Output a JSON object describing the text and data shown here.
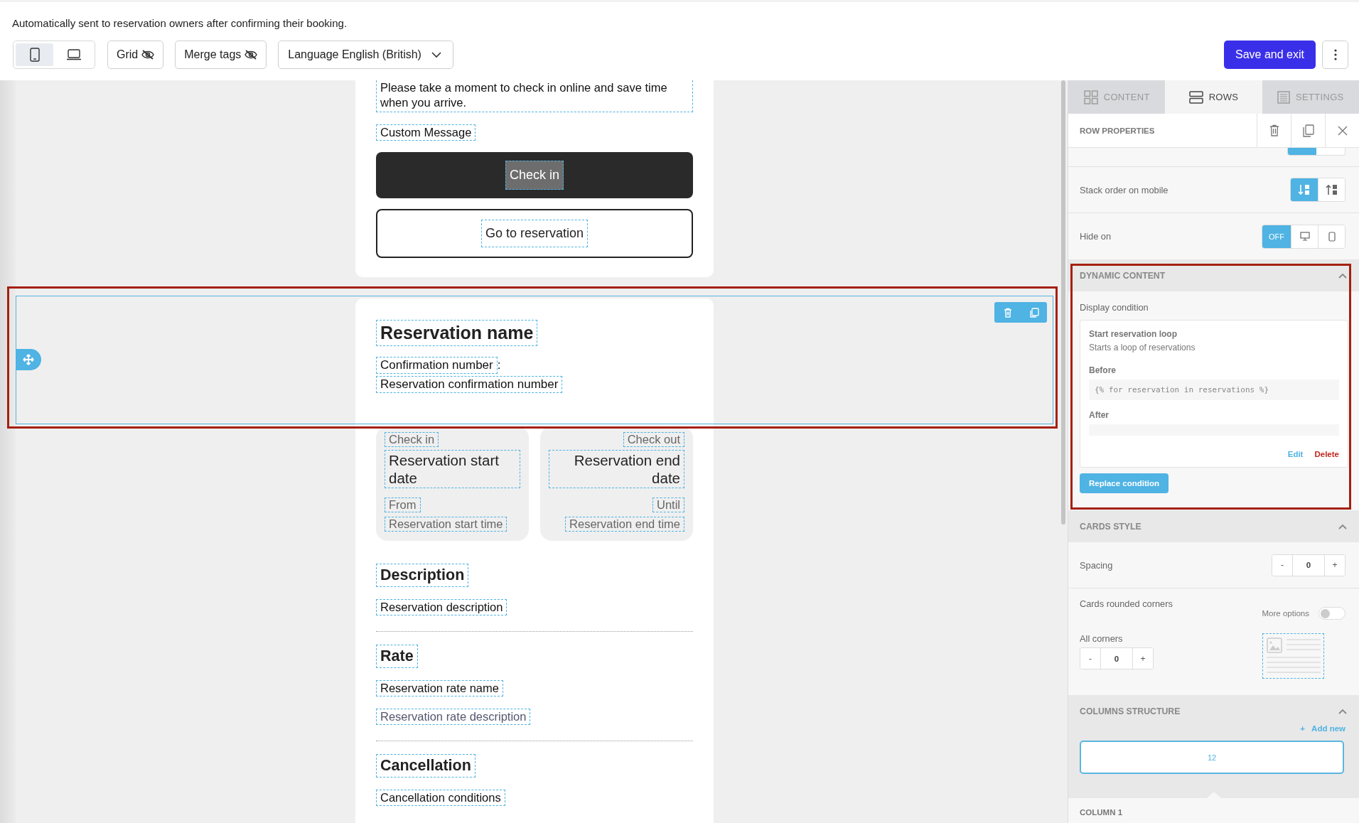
{
  "header": {
    "description": "Automatically sent to reservation owners after confirming their booking."
  },
  "toolbar": {
    "view_modes": [
      {
        "kind": "mobile",
        "selected": true
      },
      {
        "kind": "desktop",
        "selected": false
      }
    ],
    "toggles": [
      {
        "label": "Grid",
        "visible": false
      },
      {
        "label": "Merge tags",
        "visible": false
      }
    ],
    "language": "Language English (British)",
    "save_button": "Save and exit"
  },
  "email": {
    "intro_text": "Please take a moment to check in online and save time when you arrive.",
    "custom_message": "Custom Message",
    "primary_button": "Check in",
    "secondary_button": "Go to reservation",
    "selected_row": {
      "title": "Reservation name",
      "confirmation_label": "Confirmation number",
      "separator": ":",
      "confirmation_value": "Reservation confirmation number"
    },
    "stay_cards": [
      {
        "kind": "left",
        "label": "Check in",
        "date": "Reservation start date",
        "time_label": "From",
        "time": "Reservation start time"
      },
      {
        "kind": "right",
        "label": "Check out",
        "date": "Reservation end date",
        "time_label": "Until",
        "time": "Reservation end time"
      }
    ],
    "sections": [
      {
        "heading": "Description",
        "lines": [
          {
            "text": "Reservation description",
            "muted": false
          }
        ]
      },
      {
        "heading": "Rate",
        "lines": [
          {
            "text": "Reservation rate name",
            "muted": false
          },
          {
            "text": "Reservation rate description",
            "muted": true
          }
        ]
      },
      {
        "heading": "Cancellation",
        "lines": [
          {
            "text": "Cancellation conditions",
            "muted": false
          }
        ]
      }
    ]
  },
  "panel": {
    "tabs": [
      {
        "kind": "grid",
        "label": "CONTENT",
        "selected": false
      },
      {
        "kind": "rows",
        "label": "ROWS",
        "selected": true
      },
      {
        "kind": "lines",
        "label": "SETTINGS",
        "selected": false
      }
    ],
    "title": "ROW PROPERTIES",
    "partial_control": [
      {
        "selected": true
      },
      {
        "selected": false
      }
    ],
    "stack_order": {
      "label": "Stack order on mobile",
      "options": [
        {
          "kind": "down",
          "selected": true
        },
        {
          "kind": "up",
          "selected": false
        }
      ]
    },
    "hide_on": {
      "label": "Hide on",
      "options": [
        {
          "kind": "off",
          "label": "OFF",
          "selected": true
        },
        {
          "kind": "desktop",
          "selected": false
        },
        {
          "kind": "mobile",
          "selected": false
        }
      ]
    },
    "dynamic_content": {
      "title": "DYNAMIC CONTENT",
      "expanded": true,
      "field_label": "Display condition",
      "condition": {
        "name": "Start reservation loop",
        "description": "Starts a loop of reservations",
        "before_label": "Before",
        "before_value": "{% for reservation in reservations %}",
        "after_label": "After",
        "edit": "Edit",
        "delete": "Delete"
      },
      "replace_button": "Replace condition"
    },
    "cards_style": {
      "title": "CARDS STYLE",
      "expanded": true,
      "spacing": {
        "label": "Spacing",
        "minus": "-",
        "value": "0",
        "plus": "+"
      },
      "corners_label": "Cards rounded corners",
      "more_options": {
        "label": "More options",
        "on": false
      },
      "all_corners": {
        "label": "All corners",
        "minus": "-",
        "value": "0",
        "plus": "+"
      }
    },
    "columns_structure": {
      "title": "COLUMNS STRUCTURE",
      "expanded": true,
      "add_icon": "+",
      "add_new": "Add new",
      "layouts": [
        {
          "label": "12",
          "selected": true
        }
      ]
    },
    "column_title": "COLUMN 1"
  }
}
